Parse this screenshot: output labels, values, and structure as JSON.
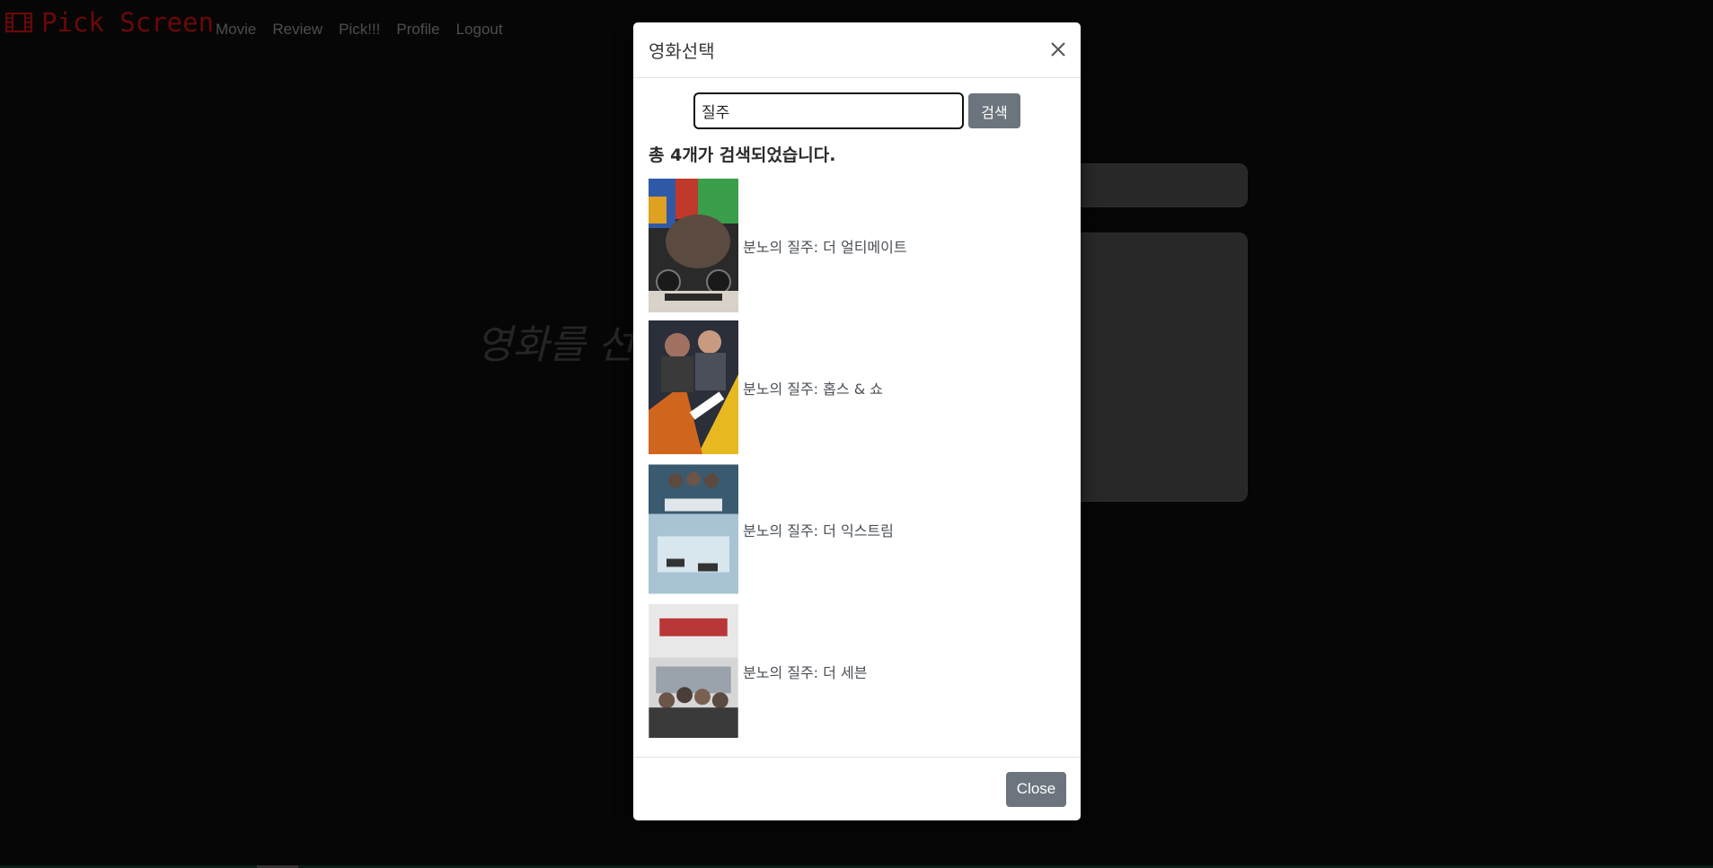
{
  "navbar": {
    "brand": "Pick Screen",
    "links": [
      "Movie",
      "Review",
      "Pick!!!",
      "Profile",
      "Logout"
    ]
  },
  "page": {
    "heading_partial": "영화를 선"
  },
  "modal": {
    "title": "영화선택",
    "search": {
      "value": "질주",
      "button_label": "검색"
    },
    "result_count": "총 4개가 검색되었습니다.",
    "results": [
      {
        "title": "분노의 질주: 더 얼티메이트"
      },
      {
        "title": "분노의 질주: 홉스 & 쇼"
      },
      {
        "title": "분노의 질주: 더 익스트림"
      },
      {
        "title": "분노의 질주: 더 세븐"
      }
    ],
    "footer": {
      "close_label": "Close"
    }
  },
  "colors": {
    "brand": "#c41010",
    "secondary_button": "#6c757d",
    "background": "#0b0b0b"
  }
}
